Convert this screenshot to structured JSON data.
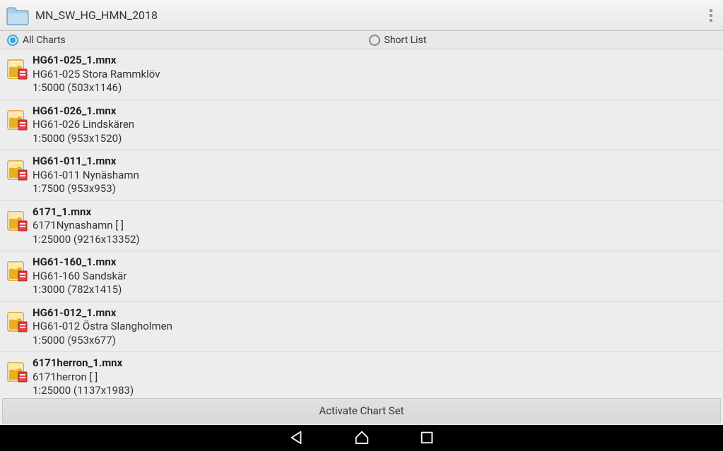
{
  "titlebar": {
    "title": "MN_SW_HG_HMN_2018"
  },
  "filter": {
    "all_charts_label": "All Charts",
    "short_list_label": "Short List"
  },
  "items": [
    {
      "filename": "HG61-025_1.mnx",
      "desc": "HG61-025 Stora Rammklöv",
      "scale": "1:5000 (503x1146)"
    },
    {
      "filename": "HG61-026_1.mnx",
      "desc": "HG61-026 Lindskären",
      "scale": "1:5000 (953x1520)"
    },
    {
      "filename": "HG61-011_1.mnx",
      "desc": "HG61-011 Nynäshamn",
      "scale": "1:7500 (953x953)"
    },
    {
      "filename": "6171_1.mnx",
      "desc": "6171Nynashamn [                    ]",
      "scale": "1:25000 (9216x13352)"
    },
    {
      "filename": "HG61-160_1.mnx",
      "desc": "HG61-160 Sandskär",
      "scale": "1:3000 (782x1415)"
    },
    {
      "filename": "HG61-012_1.mnx",
      "desc": "HG61-012 Östra Slangholmen",
      "scale": "1:5000 (953x677)"
    },
    {
      "filename": "6171herron_1.mnx",
      "desc": "6171herron [                  ]",
      "scale": "1:25000 (1137x1983)"
    }
  ],
  "activate_button_label": "Activate Chart Set"
}
